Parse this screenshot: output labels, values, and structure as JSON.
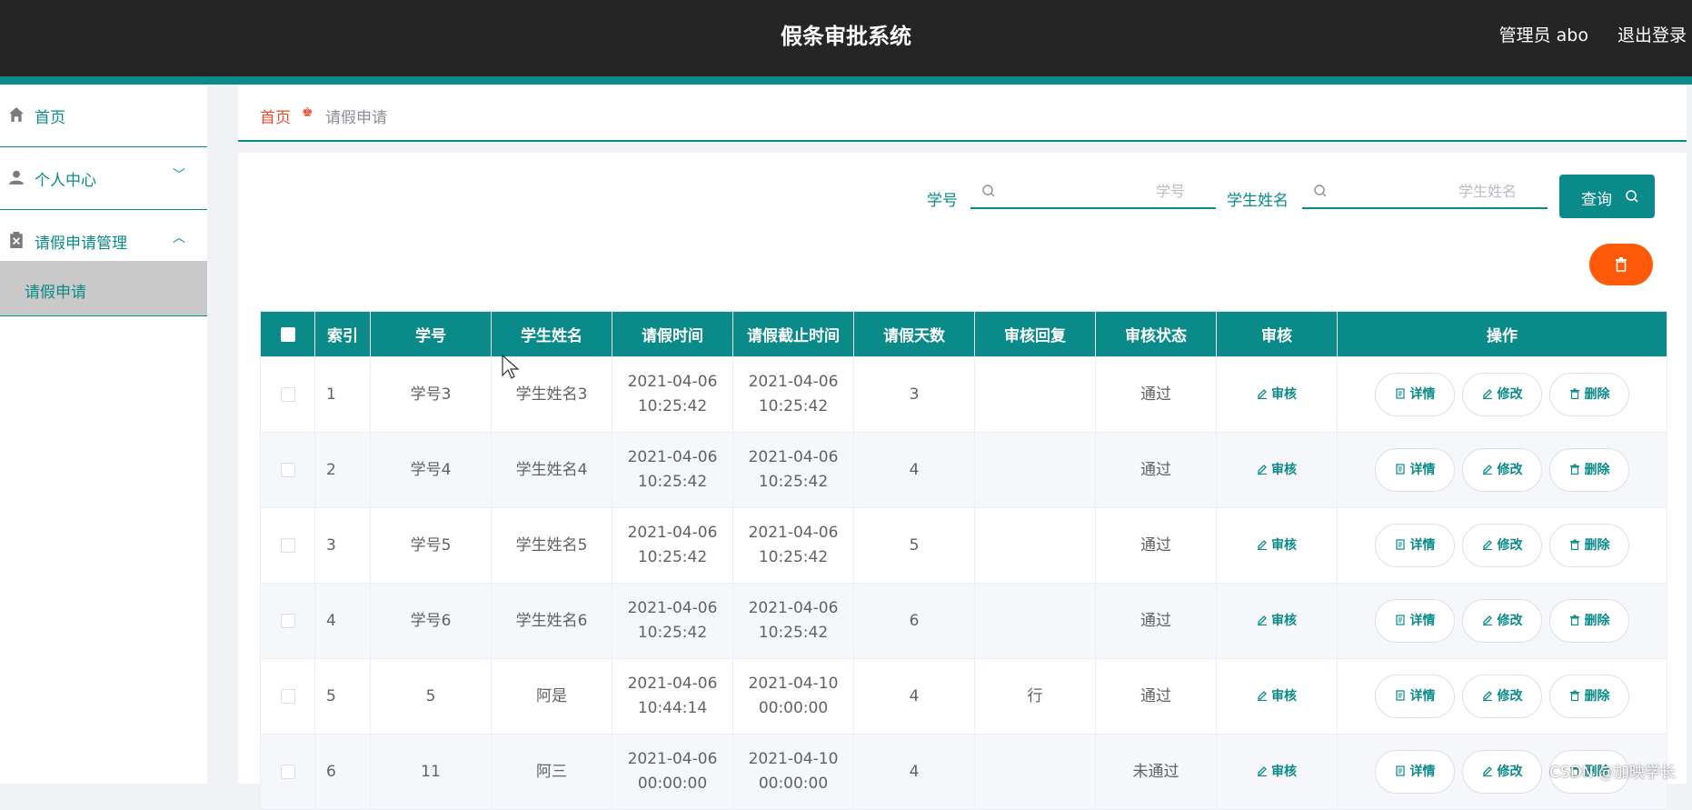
{
  "header": {
    "title": "假条审批系统",
    "user": "管理员 abo",
    "logout": "退出登录"
  },
  "sidebar": {
    "items": [
      {
        "label": "首页",
        "icon": "home-icon"
      },
      {
        "label": "个人中心",
        "icon": "user-icon",
        "chevron": "chevron-down-icon"
      },
      {
        "label": "请假申请管理",
        "icon": "clipboard-icon",
        "chevron": "chevron-up-icon"
      }
    ],
    "sub_item": "请假申请"
  },
  "breadcrumb": {
    "home": "首页",
    "current": "请假申请"
  },
  "search": {
    "student_id_label": "学号",
    "student_id_placeholder": "学号",
    "student_name_label": "学生姓名",
    "student_name_placeholder": "学生姓名",
    "query_button": "查询"
  },
  "table": {
    "columns": [
      "索引",
      "学号",
      "学生姓名",
      "请假时间",
      "请假截止时间",
      "请假天数",
      "审核回复",
      "审核状态",
      "审核",
      "操作"
    ],
    "review_action": "审核",
    "actions": {
      "detail": "详情",
      "edit": "修改",
      "delete": "删除"
    },
    "rows": [
      {
        "index": "1",
        "student_id": "学号3",
        "student_name": "学生姓名3",
        "start_date": "2021-04-06",
        "start_time": "10:25:42",
        "end_date": "2021-04-06",
        "end_time": "10:25:42",
        "days": "3",
        "reply": "",
        "status": "通过"
      },
      {
        "index": "2",
        "student_id": "学号4",
        "student_name": "学生姓名4",
        "start_date": "2021-04-06",
        "start_time": "10:25:42",
        "end_date": "2021-04-06",
        "end_time": "10:25:42",
        "days": "4",
        "reply": "",
        "status": "通过"
      },
      {
        "index": "3",
        "student_id": "学号5",
        "student_name": "学生姓名5",
        "start_date": "2021-04-06",
        "start_time": "10:25:42",
        "end_date": "2021-04-06",
        "end_time": "10:25:42",
        "days": "5",
        "reply": "",
        "status": "通过"
      },
      {
        "index": "4",
        "student_id": "学号6",
        "student_name": "学生姓名6",
        "start_date": "2021-04-06",
        "start_time": "10:25:42",
        "end_date": "2021-04-06",
        "end_time": "10:25:42",
        "days": "6",
        "reply": "",
        "status": "通过"
      },
      {
        "index": "5",
        "student_id": "5",
        "student_name": "阿是",
        "start_date": "2021-04-06",
        "start_time": "10:44:14",
        "end_date": "2021-04-10",
        "end_time": "00:00:00",
        "days": "4",
        "reply": "行",
        "status": "通过"
      },
      {
        "index": "6",
        "student_id": "11",
        "student_name": "阿三",
        "start_date": "2021-04-06",
        "start_time": "00:00:00",
        "end_date": "2021-04-10",
        "end_time": "00:00:00",
        "days": "4",
        "reply": "",
        "status": "未通过"
      }
    ]
  },
  "watermark": "CSDN @加映学长",
  "colors": {
    "primary": "#0b8a8a",
    "header_bg": "#252525",
    "danger": "#ff5a0a",
    "breadcrumb_home": "#e84a2f"
  }
}
